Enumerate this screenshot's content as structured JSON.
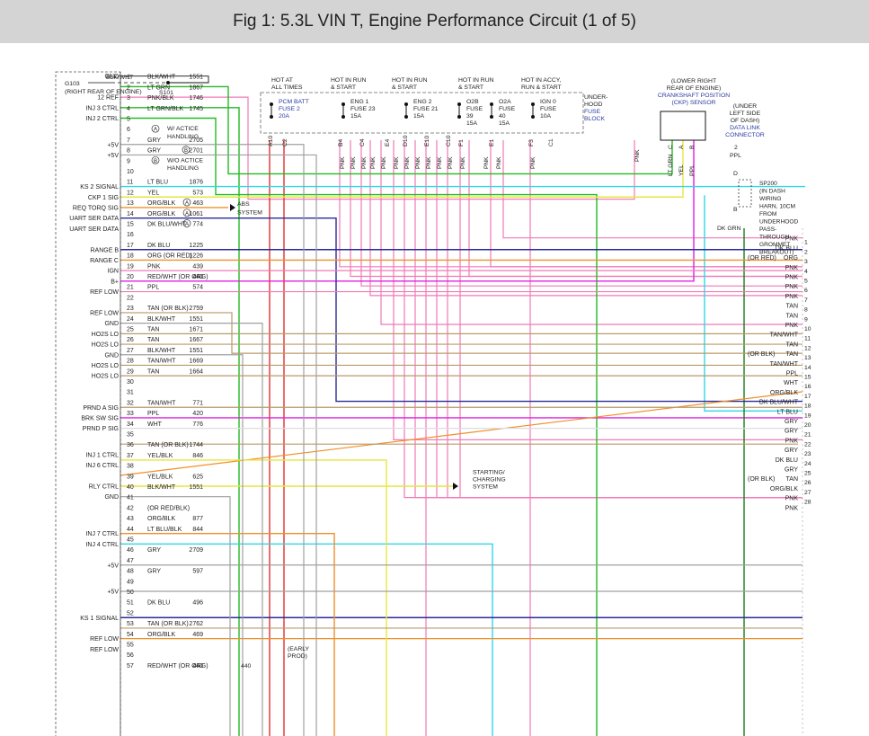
{
  "title": "Fig 1: 5.3L VIN T, Engine Performance Circuit (1 of 5)",
  "colors": {
    "pink": "#f07ab6",
    "red": "#e03030",
    "green": "#22bb22",
    "cyan": "#33d6e6",
    "yellow": "#e6e640",
    "orange": "#f0902a",
    "blue": "#2a2a9a",
    "magenta": "#e020e0",
    "tan": "#b89a6a",
    "gray": "#a0a0a0",
    "black": "#111111"
  },
  "top": {
    "ground": {
      "g103": "G103",
      "wire": "BLK/WHT",
      "loc": "(RIGHT REAR OF ENGINE)",
      "s101": "S101"
    },
    "headers": [
      "HOT AT",
      "ALL TIMES",
      "HOT IN RUN",
      "& START",
      "HOT IN RUN",
      "& START",
      "HOT IN RUN",
      "& START",
      "HOT IN ACCY,",
      "RUN & START"
    ],
    "fuses": [
      "PCM BATT",
      "FUSE 2",
      "20A",
      "ENG 1",
      "FUSE 23",
      "15A",
      "ENG 2",
      "FUSE 21",
      "15A",
      "O2B",
      "FUSE",
      "39",
      "15A",
      "O2A",
      "FUSE",
      "40",
      "15A",
      "IGN 0",
      "FUSE",
      "10A"
    ],
    "fuseblock": [
      "UNDER-",
      "HOOD",
      "FUSE",
      "BLOCK"
    ],
    "ckp": [
      "(LOWER RIGHT",
      "REAR OF ENGINE)",
      "CRANKSHAFT POSITION",
      "(CKP) SENSOR"
    ],
    "dlc": [
      "(UNDER",
      "LEFT SIDE",
      "OF DASH)",
      "DATA LINK",
      "CONNECTOR"
    ],
    "dlc_pin": "2",
    "dlc_wire": "PPL",
    "sp200": [
      "SP200",
      "(IN DASH",
      "WIRING",
      "HARN, 10CM",
      "FROM",
      "UNDERHOOD",
      "PASS-",
      "THROUGH",
      "GROMMET",
      "BREAKOUT)"
    ],
    "sp_d": "D",
    "sp_b": "B",
    "dkgrn": "DK GRN",
    "pins": [
      "A10",
      "C2",
      "B4",
      "C4",
      "E4",
      "D10",
      "E10",
      "C10",
      "F1",
      "E1",
      "F3",
      "C1"
    ],
    "ckp_pins": [
      "C",
      "A",
      "B"
    ],
    "ckp_wires": [
      "LT GRN",
      "YEL",
      "PPL"
    ],
    "pnk": "PNK"
  },
  "left_labels": [
    {
      "t": "GND",
      "p": 1
    },
    {
      "t": "12 REF",
      "p": 3
    },
    {
      "t": "INJ 3 CTRL",
      "p": 4
    },
    {
      "t": "INJ 2 CTRL",
      "p": 5
    },
    {
      "t": "+5V",
      "p": 7.5
    },
    {
      "t": "+5V",
      "p": 8.5
    },
    {
      "t": "KS 2 SIGNAL",
      "p": 11.5
    },
    {
      "t": "CKP 1 SIG",
      "p": 12.5
    },
    {
      "t": "REQ TORQ SIG",
      "p": 13.5
    },
    {
      "t": "UART SER DATA",
      "p": 14.5
    },
    {
      "t": "UART SER DATA",
      "p": 15.5
    },
    {
      "t": "RANGE B",
      "p": 17.5
    },
    {
      "t": "RANGE C",
      "p": 18.5
    },
    {
      "t": "IGN",
      "p": 19.5
    },
    {
      "t": "B+",
      "p": 20.5
    },
    {
      "t": "REF LOW",
      "p": 21.5
    },
    {
      "t": "REF LOW",
      "p": 23.5
    },
    {
      "t": "GND",
      "p": 24.5
    },
    {
      "t": "HO2S LO",
      "p": 25.5
    },
    {
      "t": "HO2S LO",
      "p": 26.5
    },
    {
      "t": "GND",
      "p": 27.5
    },
    {
      "t": "HO2S LO",
      "p": 28.5
    },
    {
      "t": "HO2S LO",
      "p": 29.5
    },
    {
      "t": "PRND A SIG",
      "p": 32.5
    },
    {
      "t": "BRK SW SIG",
      "p": 33.5
    },
    {
      "t": "PRND P SIG",
      "p": 34.5
    },
    {
      "t": "INJ 1 CTRL",
      "p": 37
    },
    {
      "t": "INJ 6 CTRL",
      "p": 38
    },
    {
      "t": "RLY CTRL",
      "p": 40
    },
    {
      "t": "GND",
      "p": 41
    },
    {
      "t": "INJ 7 CTRL",
      "p": 44.5
    },
    {
      "t": "INJ 4 CTRL",
      "p": 45.5
    },
    {
      "t": "+5V",
      "p": 47.5
    },
    {
      "t": "+5V",
      "p": 50
    },
    {
      "t": "KS 1 SIGNAL",
      "p": 52.5
    },
    {
      "t": "REF LOW",
      "p": 54.5
    },
    {
      "t": "REF LOW",
      "p": 55.5
    }
  ],
  "pin_rows": [
    {
      "n": "1",
      "w": "BLK/WHT",
      "c": "1551"
    },
    {
      "n": "2",
      "w": "LT GRN",
      "c": "1867"
    },
    {
      "n": "3",
      "w": "PNK/BLK",
      "c": "1746"
    },
    {
      "n": "4",
      "w": "LT GRN/BLK",
      "c": "1745"
    },
    {
      "n": "5",
      "w": "",
      "c": ""
    },
    {
      "n": "6",
      "w": "",
      "c": ""
    },
    {
      "n": "7",
      "w": "GRY",
      "c": "2705"
    },
    {
      "n": "8",
      "w": "GRY",
      "c": "2701"
    },
    {
      "n": "9",
      "w": "",
      "c": ""
    },
    {
      "n": "10",
      "w": "",
      "c": ""
    },
    {
      "n": "11",
      "w": "LT BLU",
      "c": "1876"
    },
    {
      "n": "12",
      "w": "YEL",
      "c": "573"
    },
    {
      "n": "13",
      "w": "ORG/BLK",
      "c": "463"
    },
    {
      "n": "14",
      "w": "ORG/BLK",
      "c": "1061"
    },
    {
      "n": "15",
      "w": "DK BLU/WHT",
      "c": "774"
    },
    {
      "n": "16",
      "w": "",
      "c": ""
    },
    {
      "n": "17",
      "w": "DK BLU",
      "c": "1225"
    },
    {
      "n": "18",
      "w": "ORG  (OR RED)",
      "c": "1226"
    },
    {
      "n": "19",
      "w": "PNK",
      "c": "439"
    },
    {
      "n": "20",
      "w": "RED/WHT   (OR ORG)",
      "c": "440"
    },
    {
      "n": "21",
      "w": "PPL",
      "c": "574"
    },
    {
      "n": "22",
      "w": "",
      "c": ""
    },
    {
      "n": "23",
      "w": "TAN   (OR BLK)",
      "c": "2759"
    },
    {
      "n": "24",
      "w": "BLK/WHT",
      "c": "1551"
    },
    {
      "n": "25",
      "w": "TAN",
      "c": "1671"
    },
    {
      "n": "26",
      "w": "TAN",
      "c": "1667"
    },
    {
      "n": "27",
      "w": "BLK/WHT",
      "c": "1551"
    },
    {
      "n": "28",
      "w": "TAN/WHT",
      "c": "1669"
    },
    {
      "n": "29",
      "w": "TAN",
      "c": "1664"
    },
    {
      "n": "30",
      "w": "",
      "c": ""
    },
    {
      "n": "31",
      "w": "",
      "c": ""
    },
    {
      "n": "32",
      "w": "TAN/WHT",
      "c": "771"
    },
    {
      "n": "33",
      "w": "PPL",
      "c": "420"
    },
    {
      "n": "34",
      "w": "WHT",
      "c": "776"
    },
    {
      "n": "35",
      "w": "",
      "c": ""
    },
    {
      "n": "36",
      "w": "TAN  (OR BLK)",
      "c": "1744"
    },
    {
      "n": "37",
      "w": "YEL/BLK",
      "c": "846"
    },
    {
      "n": "38",
      "w": "",
      "c": ""
    },
    {
      "n": "39",
      "w": "YEL/BLK",
      "c": "625"
    },
    {
      "n": "40",
      "w": "BLK/WHT",
      "c": "1551"
    },
    {
      "n": "41",
      "w": "",
      "c": ""
    },
    {
      "n": "42",
      "w": "(OR RED/BLK)",
      "c": ""
    },
    {
      "n": "43",
      "w": "ORG/BLK",
      "c": "877"
    },
    {
      "n": "44",
      "w": "LT BLU/BLK",
      "c": "844"
    },
    {
      "n": "45",
      "w": "",
      "c": ""
    },
    {
      "n": "46",
      "w": "GRY",
      "c": "2709"
    },
    {
      "n": "47",
      "w": "",
      "c": ""
    },
    {
      "n": "48",
      "w": "GRY",
      "c": "597"
    },
    {
      "n": "49",
      "w": "",
      "c": ""
    },
    {
      "n": "50",
      "w": "",
      "c": ""
    },
    {
      "n": "51",
      "w": "DK BLU",
      "c": "496"
    },
    {
      "n": "52",
      "w": "",
      "c": ""
    },
    {
      "n": "53",
      "w": "TAN  (OR BLK)",
      "c": "2762"
    },
    {
      "n": "54",
      "w": "ORG/BLK",
      "c": "469"
    },
    {
      "n": "55",
      "w": "",
      "c": ""
    },
    {
      "n": "56",
      "w": "",
      "c": ""
    },
    {
      "n": "57",
      "w": "RED/WHT   (OR ORG)",
      "c": "440"
    }
  ],
  "circled": [
    {
      "p": 6,
      "t": "A"
    },
    {
      "p": 8,
      "t": "B"
    },
    {
      "p": 9,
      "t": "B"
    },
    {
      "p": 13,
      "t": "A"
    },
    {
      "p": 14,
      "t": "A"
    },
    {
      "p": 15,
      "t": "A"
    }
  ],
  "notes": {
    "active": [
      "W/ ACTICE",
      "HANDLING"
    ],
    "noactive": [
      "W/O ACTICE",
      "HANDLING"
    ],
    "abs": [
      "ABS",
      "SYSTEM"
    ],
    "start": [
      "STARTING/",
      "CHARGING",
      "SYSTEM"
    ],
    "early": [
      "(EARLY",
      "PROD)"
    ],
    "early_code": "440"
  },
  "right_labels": [
    {
      "t": "PNK",
      "n": "1"
    },
    {
      "t": "DK BLU",
      "n": "2"
    },
    {
      "t": "ORG",
      "n": "3",
      "pre": "(OR RED)"
    },
    {
      "t": "PNK",
      "n": "4"
    },
    {
      "t": "PNK",
      "n": "5"
    },
    {
      "t": "PNK",
      "n": "6"
    },
    {
      "t": "PNK",
      "n": "7"
    },
    {
      "t": "TAN",
      "n": "8"
    },
    {
      "t": "TAN",
      "n": "9"
    },
    {
      "t": "PNK",
      "n": "10"
    },
    {
      "t": "TAN/WHT",
      "n": "11"
    },
    {
      "t": "TAN",
      "n": "12"
    },
    {
      "t": "TAN",
      "n": "13",
      "pre": "(OR BLK)"
    },
    {
      "t": "TAN/WHT",
      "n": "14"
    },
    {
      "t": "PPL",
      "n": "15"
    },
    {
      "t": "WHT",
      "n": "16"
    },
    {
      "t": "ORG/BLK",
      "n": "17"
    },
    {
      "t": "DK BLU/WHT",
      "n": "18"
    },
    {
      "t": "LT BLU",
      "n": "19"
    },
    {
      "t": "GRY",
      "n": "20"
    },
    {
      "t": "GRY",
      "n": "21"
    },
    {
      "t": "PNK",
      "n": "22"
    },
    {
      "t": "GRY",
      "n": "23"
    },
    {
      "t": "DK BLU",
      "n": "24"
    },
    {
      "t": "GRY",
      "n": "25"
    },
    {
      "t": "TAN",
      "n": "26",
      "pre": "(OR BLK)"
    },
    {
      "t": "ORG/BLK",
      "n": "27"
    },
    {
      "t": "PNK",
      "n": "28"
    },
    {
      "t": "PNK",
      "n": ""
    }
  ]
}
